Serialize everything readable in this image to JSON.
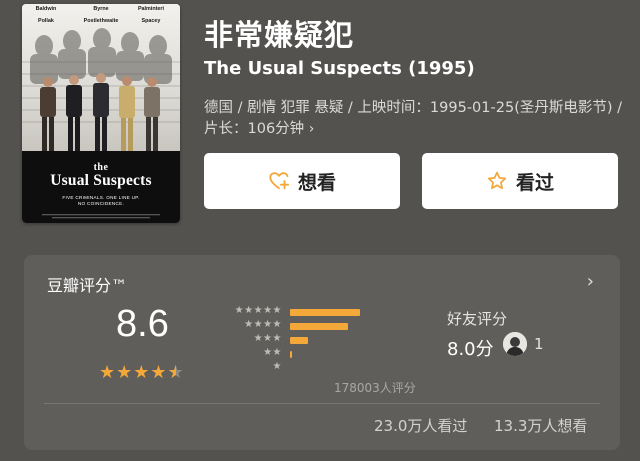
{
  "poster": {
    "credits": [
      "Baldwin",
      "Byrne",
      "Palminteri",
      "Pollak",
      "Postlethwaite",
      "Spacey"
    ],
    "title_line1": "the",
    "title_line2": "Usual Suspects",
    "tagline_line1": "FIVE CRIMINALS.  ONE LINE UP.",
    "tagline_line2": "NO COINCIDENCE."
  },
  "movie": {
    "title_cn": "非常嫌疑犯",
    "title_en": "The Usual Suspects (1995)",
    "meta": "德国 / 剧情 犯罪 悬疑 / 上映时间：1995-01-25(圣丹斯电影节) / 片长：106分钟",
    "meta_chevron": "›"
  },
  "actions": {
    "want_label": "想看",
    "seen_label": "看过",
    "want_icon": "heart-plus-icon",
    "seen_icon": "star-outline-icon"
  },
  "rating": {
    "title": "豆瓣评分™",
    "score": "8.6",
    "star_value": 4.5,
    "distribution": [
      {
        "stars": "★★★★★",
        "fraction": 0.47
      },
      {
        "stars": "★★★★",
        "fraction": 0.39
      },
      {
        "stars": "★★★",
        "fraction": 0.12
      },
      {
        "stars": "★★",
        "fraction": 0.01
      },
      {
        "stars": "★",
        "fraction": 0.0
      }
    ],
    "count_text": "178003人评分",
    "friends_label": "好友评分",
    "friends_score": "8.0分",
    "friends_count": "1",
    "seen_text": "23.0万人看过",
    "want_text": "13.3万人想看",
    "accent_color": "#f4a83a"
  }
}
